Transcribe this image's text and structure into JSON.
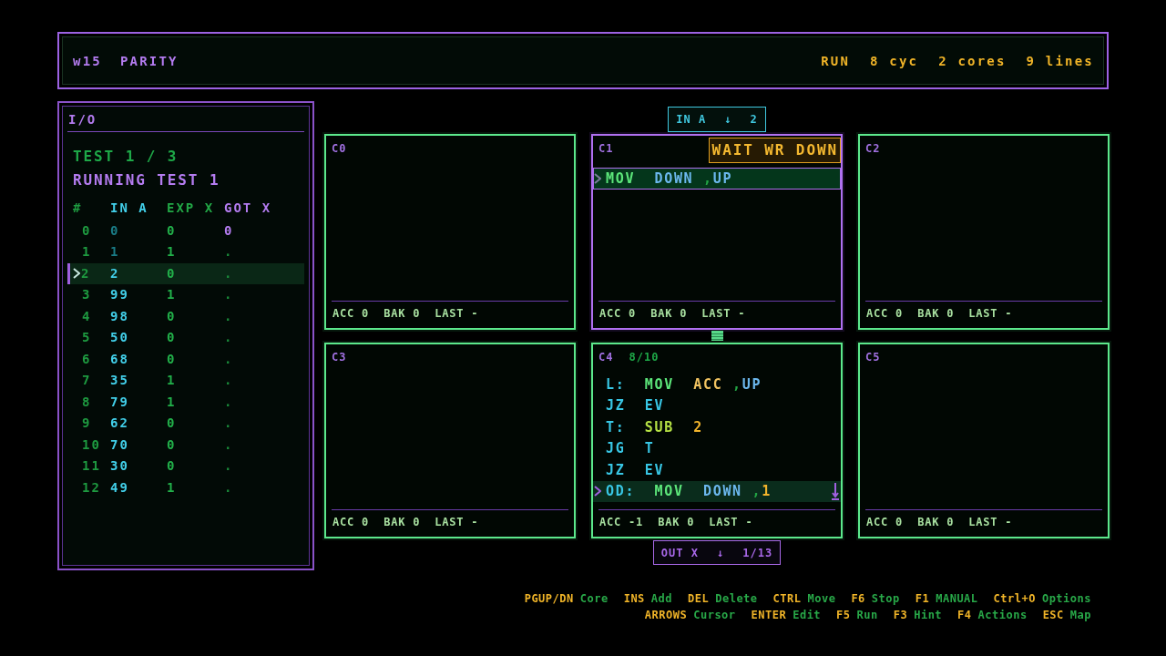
{
  "header": {
    "level": "w15",
    "name": "PARITY",
    "stats": [
      "RUN",
      "8 cyc",
      "2 cores",
      "9 lines"
    ]
  },
  "io_panel": {
    "title": "I/O",
    "test_counter": "TEST 1 / 3",
    "status": "RUNNING TEST 1",
    "columns": [
      {
        "label": "#",
        "kind": "index"
      },
      {
        "label": "IN A",
        "kind": "input"
      },
      {
        "label": "EXP X",
        "kind": "expected"
      },
      {
        "label": "GOT X",
        "kind": "got"
      }
    ],
    "rows": [
      {
        "cells": [
          "0",
          "0",
          "0",
          "0"
        ],
        "selected": false,
        "consumed": true,
        "received": true
      },
      {
        "cells": [
          "1",
          "1",
          "1",
          "."
        ],
        "selected": false,
        "consumed": true,
        "received": false
      },
      {
        "cells": [
          "2",
          "2",
          "0",
          "."
        ],
        "selected": true,
        "consumed": false,
        "received": false
      },
      {
        "cells": [
          "3",
          "99",
          "1",
          "."
        ],
        "selected": false,
        "consumed": false,
        "received": false
      },
      {
        "cells": [
          "4",
          "98",
          "0",
          "."
        ],
        "selected": false,
        "consumed": false,
        "received": false
      },
      {
        "cells": [
          "5",
          "50",
          "0",
          "."
        ],
        "selected": false,
        "consumed": false,
        "received": false
      },
      {
        "cells": [
          "6",
          "68",
          "0",
          "."
        ],
        "selected": false,
        "consumed": false,
        "received": false
      },
      {
        "cells": [
          "7",
          "35",
          "1",
          "."
        ],
        "selected": false,
        "consumed": false,
        "received": false
      },
      {
        "cells": [
          "8",
          "79",
          "1",
          "."
        ],
        "selected": false,
        "consumed": false,
        "received": false
      },
      {
        "cells": [
          "9",
          "62",
          "0",
          "."
        ],
        "selected": false,
        "consumed": false,
        "received": false
      },
      {
        "cells": [
          "10",
          "70",
          "0",
          "."
        ],
        "selected": false,
        "consumed": false,
        "received": false
      },
      {
        "cells": [
          "11",
          "30",
          "0",
          "."
        ],
        "selected": false,
        "consumed": false,
        "received": false
      },
      {
        "cells": [
          "12",
          "49",
          "1",
          "."
        ],
        "selected": false,
        "consumed": false,
        "received": false
      }
    ]
  },
  "cores": [
    {
      "label": "C0",
      "selected": false,
      "linked_down": false,
      "registers": [
        {
          "name": "ACC",
          "value": "0"
        },
        {
          "name": "BAK",
          "value": "0"
        },
        {
          "name": "LAST",
          "value": "-"
        }
      ]
    },
    {
      "label": "C1",
      "selected": true,
      "linked_down": true,
      "input_port": {
        "label": "IN A",
        "arrow": "↓",
        "value": "2"
      },
      "status": "WAIT WR DOWN",
      "lines": [
        {
          "current": true,
          "tokens": [
            {
              "text": "MOV",
              "kind": "op"
            },
            {
              "text": "DOWN",
              "kind": "port"
            },
            {
              "text": ",",
              "kind": "sep"
            },
            {
              "text": "UP",
              "kind": "port"
            }
          ]
        }
      ],
      "registers": [
        {
          "name": "ACC",
          "value": "0"
        },
        {
          "name": "BAK",
          "value": "0"
        },
        {
          "name": "LAST",
          "value": "-"
        }
      ]
    },
    {
      "label": "C2",
      "selected": false,
      "linked_down": false,
      "registers": [
        {
          "name": "ACC",
          "value": "0"
        },
        {
          "name": "BAK",
          "value": "0"
        },
        {
          "name": "LAST",
          "value": "-"
        }
      ]
    },
    {
      "label": "C3",
      "selected": false,
      "registers": [
        {
          "name": "ACC",
          "value": "0"
        },
        {
          "name": "BAK",
          "value": "0"
        },
        {
          "name": "LAST",
          "value": "-"
        }
      ]
    },
    {
      "label": "C4",
      "count": "8/10",
      "selected": false,
      "more_below": true,
      "output_port": {
        "label": "OUT X",
        "arrow": "↓",
        "value": "1/13"
      },
      "lines": [
        {
          "current": false,
          "tokens": [
            {
              "text": "L:",
              "kind": "label"
            },
            {
              "text": "MOV",
              "kind": "op"
            },
            {
              "text": "ACC",
              "kind": "reg"
            },
            {
              "text": ",",
              "kind": "sep"
            },
            {
              "text": "UP",
              "kind": "port"
            }
          ]
        },
        {
          "current": false,
          "tokens": [
            {
              "text": "JZ",
              "kind": "jump"
            },
            {
              "text": "EV",
              "kind": "ref"
            }
          ]
        },
        {
          "current": false,
          "tokens": [
            {
              "text": "T:",
              "kind": "label"
            },
            {
              "text": "SUB",
              "kind": "arith"
            },
            {
              "text": "2",
              "kind": "num"
            }
          ]
        },
        {
          "current": false,
          "tokens": [
            {
              "text": "JG",
              "kind": "jump"
            },
            {
              "text": "T",
              "kind": "ref"
            }
          ]
        },
        {
          "current": false,
          "tokens": [
            {
              "text": "JZ",
              "kind": "jump"
            },
            {
              "text": "EV",
              "kind": "ref"
            }
          ]
        },
        {
          "current": true,
          "tokens": [
            {
              "text": "OD:",
              "kind": "label"
            },
            {
              "text": "MOV",
              "kind": "op"
            },
            {
              "text": "DOWN",
              "kind": "port"
            },
            {
              "text": ",",
              "kind": "sep"
            },
            {
              "text": "1",
              "kind": "num"
            }
          ]
        }
      ],
      "registers": [
        {
          "name": "ACC",
          "value": "-1"
        },
        {
          "name": "BAK",
          "value": "0"
        },
        {
          "name": "LAST",
          "value": "-"
        }
      ]
    },
    {
      "label": "C5",
      "selected": false,
      "registers": [
        {
          "name": "ACC",
          "value": "0"
        },
        {
          "name": "BAK",
          "value": "0"
        },
        {
          "name": "LAST",
          "value": "-"
        }
      ]
    }
  ],
  "hint_rows": [
    {
      "items": [
        {
          "key": "PGUP/DN",
          "action": "Core"
        },
        {
          "key": "INS",
          "action": "Add"
        },
        {
          "key": "DEL",
          "action": "Delete"
        },
        {
          "key": "CTRL",
          "action": "Move"
        },
        {
          "key": "F6",
          "action": "Stop"
        },
        {
          "key": "F1",
          "action": "MANUAL"
        },
        {
          "key": "Ctrl+O",
          "action": "Options"
        }
      ]
    },
    {
      "items": [
        {
          "key": "ARROWS",
          "action": "Cursor"
        },
        {
          "key": "ENTER",
          "action": "Edit"
        },
        {
          "key": "F5",
          "action": "Run"
        },
        {
          "key": "F3",
          "action": "Hint"
        },
        {
          "key": "F4",
          "action": "Actions"
        },
        {
          "key": "ESC",
          "action": "Map"
        }
      ]
    }
  ]
}
